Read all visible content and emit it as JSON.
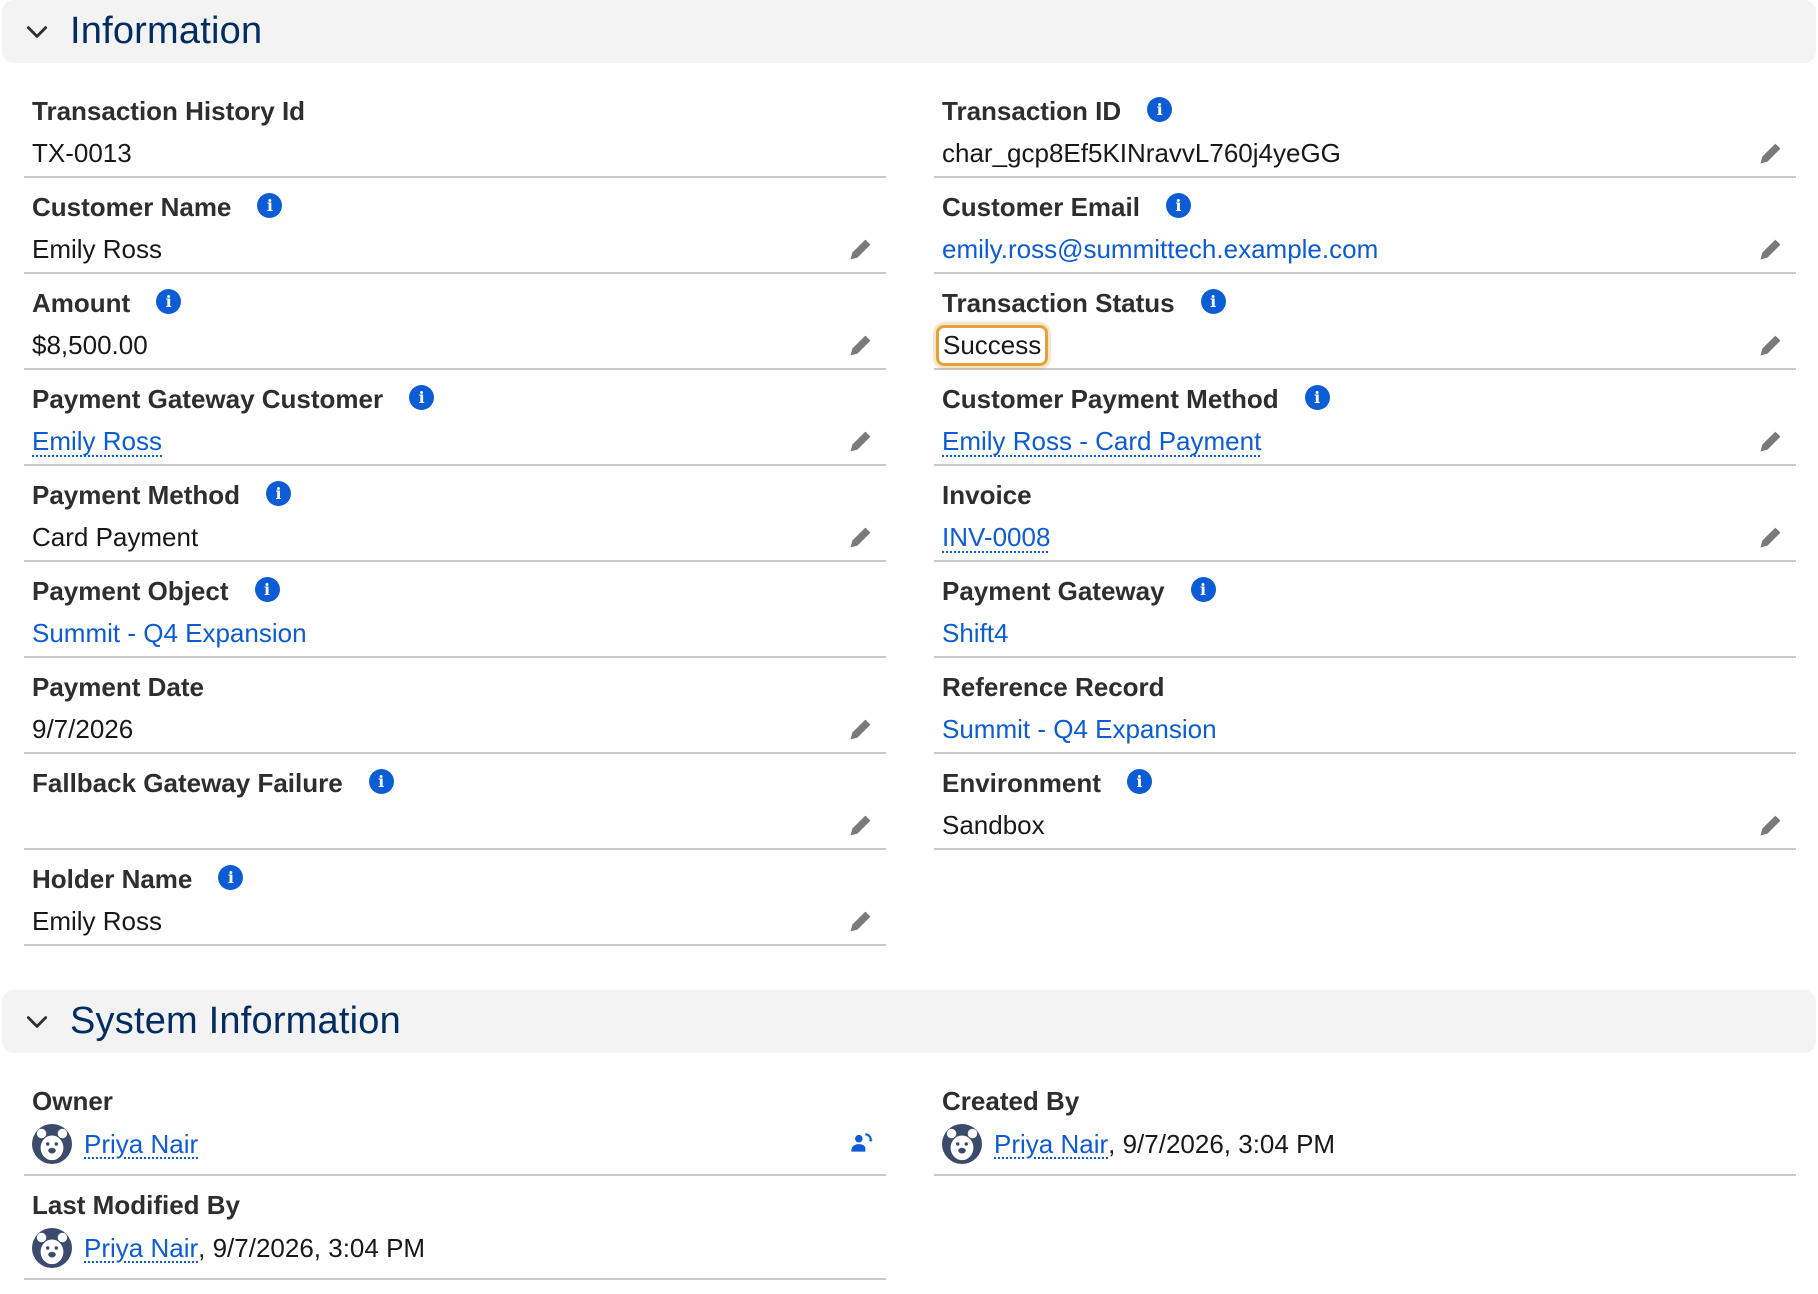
{
  "sections": {
    "information": {
      "title": "Information"
    },
    "system": {
      "title": "System Information"
    }
  },
  "left_fields": [
    {
      "label": "Transaction History Id",
      "value": "TX-0013"
    },
    {
      "label": "Customer Name",
      "value": "Emily Ross"
    },
    {
      "label": "Amount",
      "value": "$8,500.00"
    },
    {
      "label": "Payment Gateway Customer",
      "value": "Emily Ross"
    },
    {
      "label": "Payment Method",
      "value": "Card Payment"
    },
    {
      "label": "Payment Object",
      "value": "Summit - Q4 Expansion"
    },
    {
      "label": "Payment Date",
      "value": "9/7/2026"
    },
    {
      "label": "Fallback Gateway Failure",
      "value": ""
    },
    {
      "label": "Holder Name",
      "value": "Emily Ross"
    }
  ],
  "right_fields": [
    {
      "label": "Transaction ID",
      "value": "char_gcp8Ef5KINravvL760j4yeGG"
    },
    {
      "label": "Customer Email",
      "value": "emily.ross@summittech.example.com"
    },
    {
      "label": "Transaction Status",
      "value": "Success"
    },
    {
      "label": "Customer Payment Method",
      "value": "Emily Ross - Card Payment"
    },
    {
      "label": "Invoice",
      "value": "INV-0008"
    },
    {
      "label": "Payment Gateway",
      "value": "Shift4"
    },
    {
      "label": "Reference Record",
      "value": "Summit - Q4 Expansion"
    },
    {
      "label": "Environment",
      "value": "Sandbox"
    }
  ],
  "system_fields": {
    "owner": {
      "label": "Owner",
      "user": "Priya Nair"
    },
    "created_by": {
      "label": "Created By",
      "user": "Priya Nair",
      "timestamp": ", 9/7/2026, 3:04 PM"
    },
    "last_modified_by": {
      "label": "Last Modified By",
      "user": "Priya Nair",
      "timestamp": ", 9/7/2026, 3:04 PM"
    }
  },
  "icons": {
    "info": "info-icon",
    "edit": "pencil-icon",
    "chevron": "chevron-down-icon",
    "change_owner": "change-owner-icon",
    "avatar": "user-avatar-icon"
  },
  "colors": {
    "link": "#0b5cd5",
    "header_bg": "#f3f3f3",
    "section_title": "#032d60",
    "focus_ring": "#e3a13b"
  }
}
